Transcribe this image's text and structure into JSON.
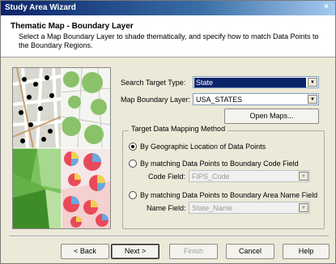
{
  "window": {
    "title": "Study Area Wizard",
    "close_glyph": "×"
  },
  "header": {
    "title": "Thematic Map - Boundary Layer",
    "description": "Select a Map Boundary Layer to shade thematically, and specify how to match Data Points to the Boundary Regions."
  },
  "form": {
    "search_target_label": "Search Target Type:",
    "search_target_value": "State",
    "boundary_layer_label": "Map Boundary Layer:",
    "boundary_layer_value": "USA_STATES",
    "open_maps_label": "Open Maps..."
  },
  "mapping": {
    "group_label": "Target Data Mapping Method",
    "option_geo": "By Geographic Location of Data Points",
    "option_code": "By matching Data Points to Boundary Code Field",
    "code_field_label": "Code Field:",
    "code_field_value": "FIPS_Code",
    "option_name": "By matching Data Points to Boundary Area Name Field",
    "name_field_label": "Name Field:",
    "name_field_value": "State_Name",
    "selected": "geo"
  },
  "footer": {
    "back_label": "< Back",
    "next_label": "Next >",
    "finish_label": "Finish",
    "cancel_label": "Cancel",
    "help_label": "Help"
  },
  "colors": {
    "title_bar": "#0a246a",
    "selection": "#0a246a",
    "dialog_bg": "#ece9d8"
  },
  "icons": [
    "close-icon",
    "dropdown-arrow-icon",
    "radio-icon"
  ]
}
